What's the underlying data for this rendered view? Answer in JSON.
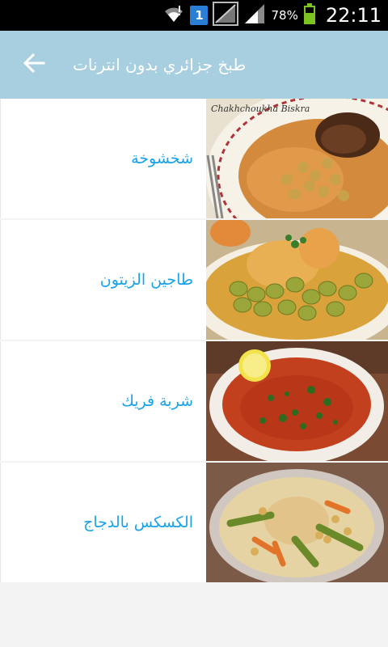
{
  "status_bar": {
    "sim_number": "1",
    "battery_percent": "78%",
    "time": "22:11",
    "icons": [
      "wifi-icon",
      "sim-icon",
      "no-signal-icon",
      "signal-icon",
      "battery-charging-icon"
    ]
  },
  "app_bar": {
    "title": "طبخ جزائري بدون انترنات",
    "back_icon": "arrow-left-icon",
    "color": "#a7cfe0"
  },
  "recipes": [
    {
      "name": "شخشوخة",
      "image": "chakhchoukha-dish-photo",
      "image_caption": "Chakhchoukha Biskra"
    },
    {
      "name": "طاجين الزيتون",
      "image": "olive-tagine-dish-photo"
    },
    {
      "name": "شربة فريك",
      "image": "chorba-frik-soup-photo"
    },
    {
      "name": "الكسكس بالدجاج",
      "image": "chicken-couscous-dish-photo"
    }
  ],
  "colors": {
    "accent_text": "#1aa3e8",
    "app_bar": "#a7cfe0",
    "background": "#f3f3f3"
  }
}
